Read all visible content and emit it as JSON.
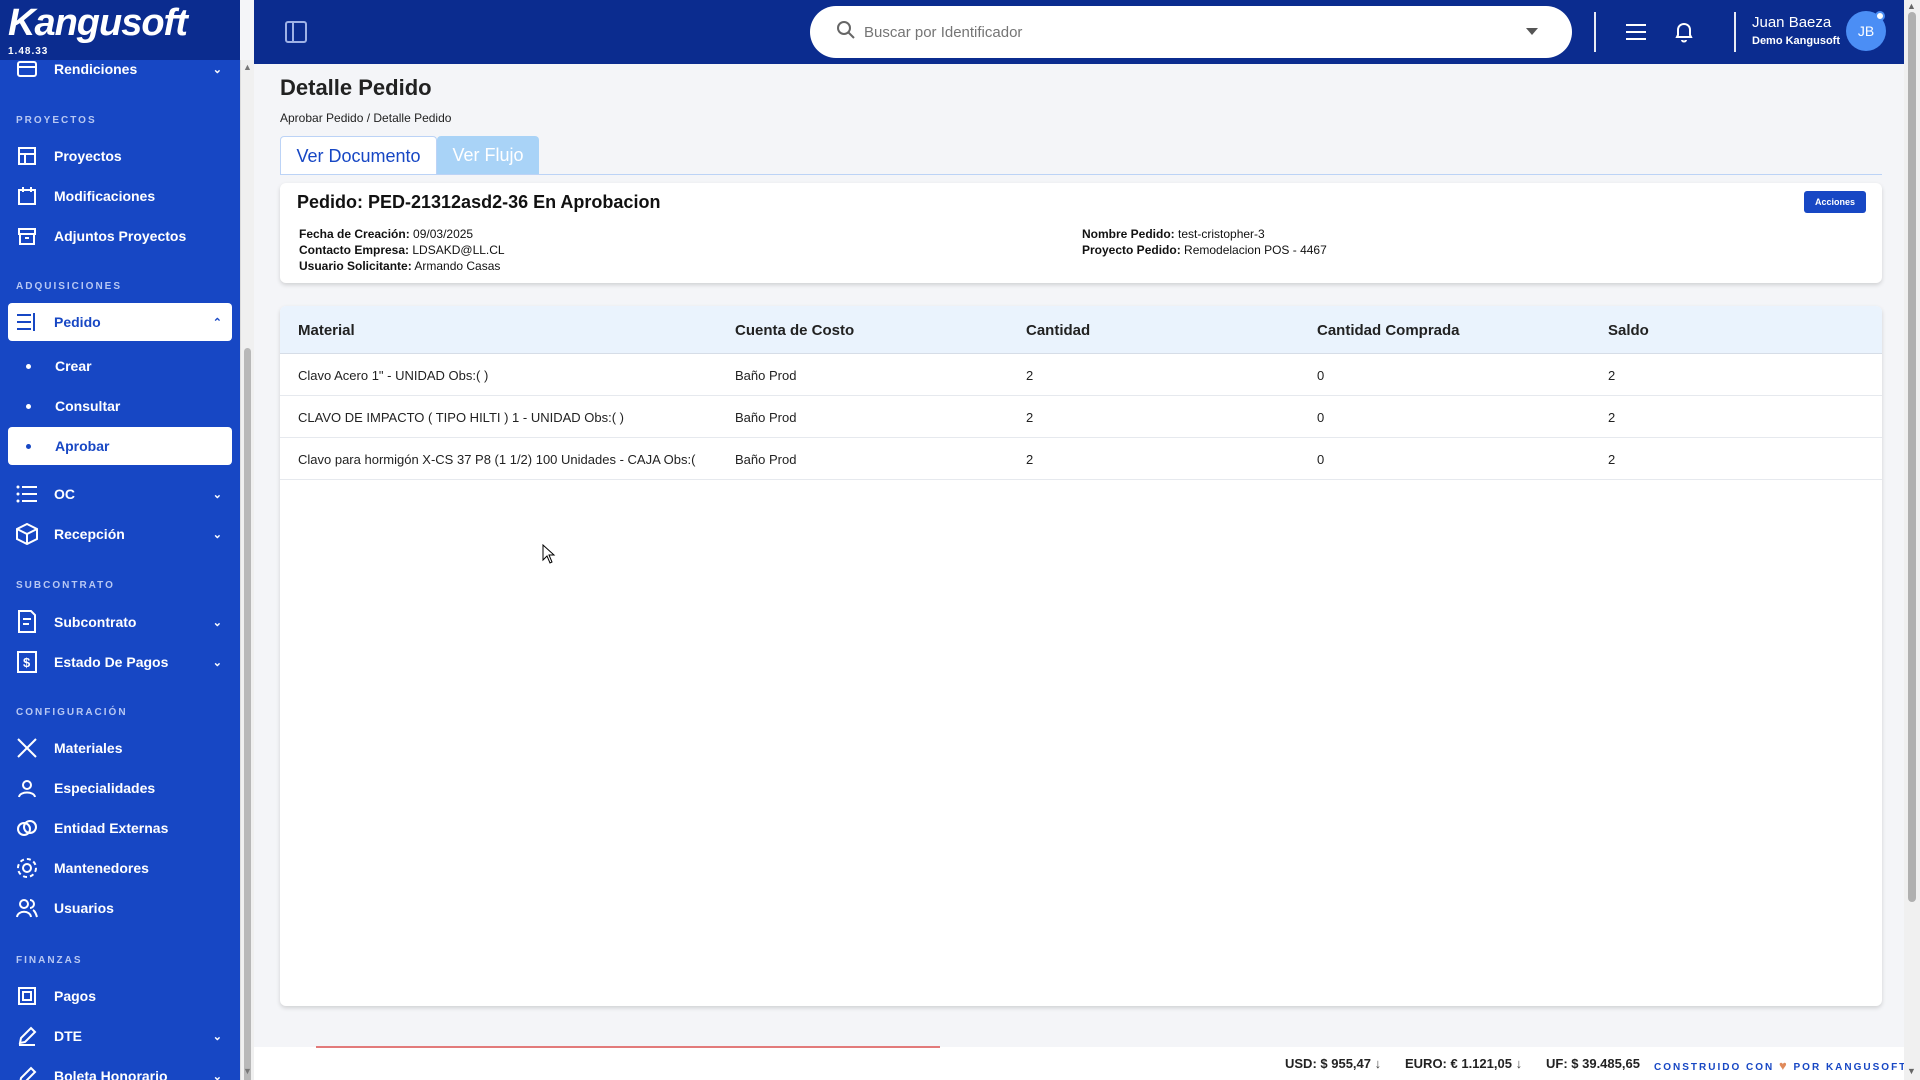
{
  "app": {
    "logo": "Kangusoft",
    "version": "1.48.33"
  },
  "sidebar": {
    "top_item": {
      "label": "Rendiciones",
      "icon": "card-icon"
    },
    "sections": {
      "proyectos": "PROYECTOS",
      "adquisiciones": "ADQUISICIONES",
      "subcontrato": "SUBCONTRATO",
      "configuracion": "CONFIGURACIÓN",
      "finanzas": "FINANZAS"
    },
    "items": {
      "proyectos": "Proyectos",
      "modificaciones": "Modificaciones",
      "adjuntos": "Adjuntos Proyectos",
      "pedido": "Pedido",
      "crear": "Crear",
      "consultar": "Consultar",
      "aprobar": "Aprobar",
      "oc": "OC",
      "recepcion": "Recepción",
      "subcontrato": "Subcontrato",
      "estado_pagos": "Estado De Pagos",
      "materiales": "Materiales",
      "especialidades": "Especialidades",
      "entidad_externas": "Entidad Externas",
      "mantenedores": "Mantenedores",
      "usuarios": "Usuarios",
      "pagos": "Pagos",
      "dte": "DTE",
      "boleta": "Boleta Honorario"
    }
  },
  "header": {
    "search_placeholder": "Buscar por Identificador",
    "user_name": "Juan Baeza",
    "user_org": "Demo Kangusoft",
    "avatar_initials": "JB"
  },
  "page": {
    "title": "Detalle Pedido",
    "breadcrumb": "Aprobar Pedido / Detalle Pedido",
    "tabs": [
      "Ver Documento",
      "Ver Flujo"
    ]
  },
  "pedido": {
    "title": "Pedido: PED-21312asd2-36 En Aprobacion",
    "actions_label": "Acciones",
    "fecha_label": "Fecha de Creación:",
    "fecha_value": "09/03/2025",
    "contacto_label": "Contacto Empresa:",
    "contacto_value": "LDSAKD@LL.CL",
    "usuario_label": "Usuario Solicitante:",
    "usuario_value": "Armando Casas",
    "nombre_label": "Nombre Pedido:",
    "nombre_value": "test-cristopher-3",
    "proyecto_label": "Proyecto Pedido:",
    "proyecto_value": "Remodelacion POS - 4467"
  },
  "table": {
    "columns": [
      "Material",
      "Cuenta de Costo",
      "Cantidad",
      "Cantidad Comprada",
      "Saldo"
    ],
    "rows": [
      [
        "Clavo Acero 1\" - UNIDAD Obs:( )",
        "Baño Prod",
        "2",
        "0",
        "2"
      ],
      [
        "CLAVO DE IMPACTO ( TIPO HILTI ) 1 - UNIDAD Obs:( )",
        "Baño Prod",
        "2",
        "0",
        "2"
      ],
      [
        "Clavo para hormigón X-CS 37 P8 (1 1/2) 100 Unidades - CAJA Obs:(",
        "Baño Prod",
        "2",
        "0",
        "2"
      ]
    ]
  },
  "footer": {
    "usd": "USD: $ 955,47",
    "euro": "EURO: € 1.121,05",
    "uf": "UF: $ 39.485,65",
    "brand_pre": "CONSTRUIDO CON",
    "brand_post": "POR KANGUSOFT"
  },
  "colors": {
    "primary": "#1747c4",
    "header": "#0b2c8f",
    "tab_inactive": "#a9d3f7"
  }
}
